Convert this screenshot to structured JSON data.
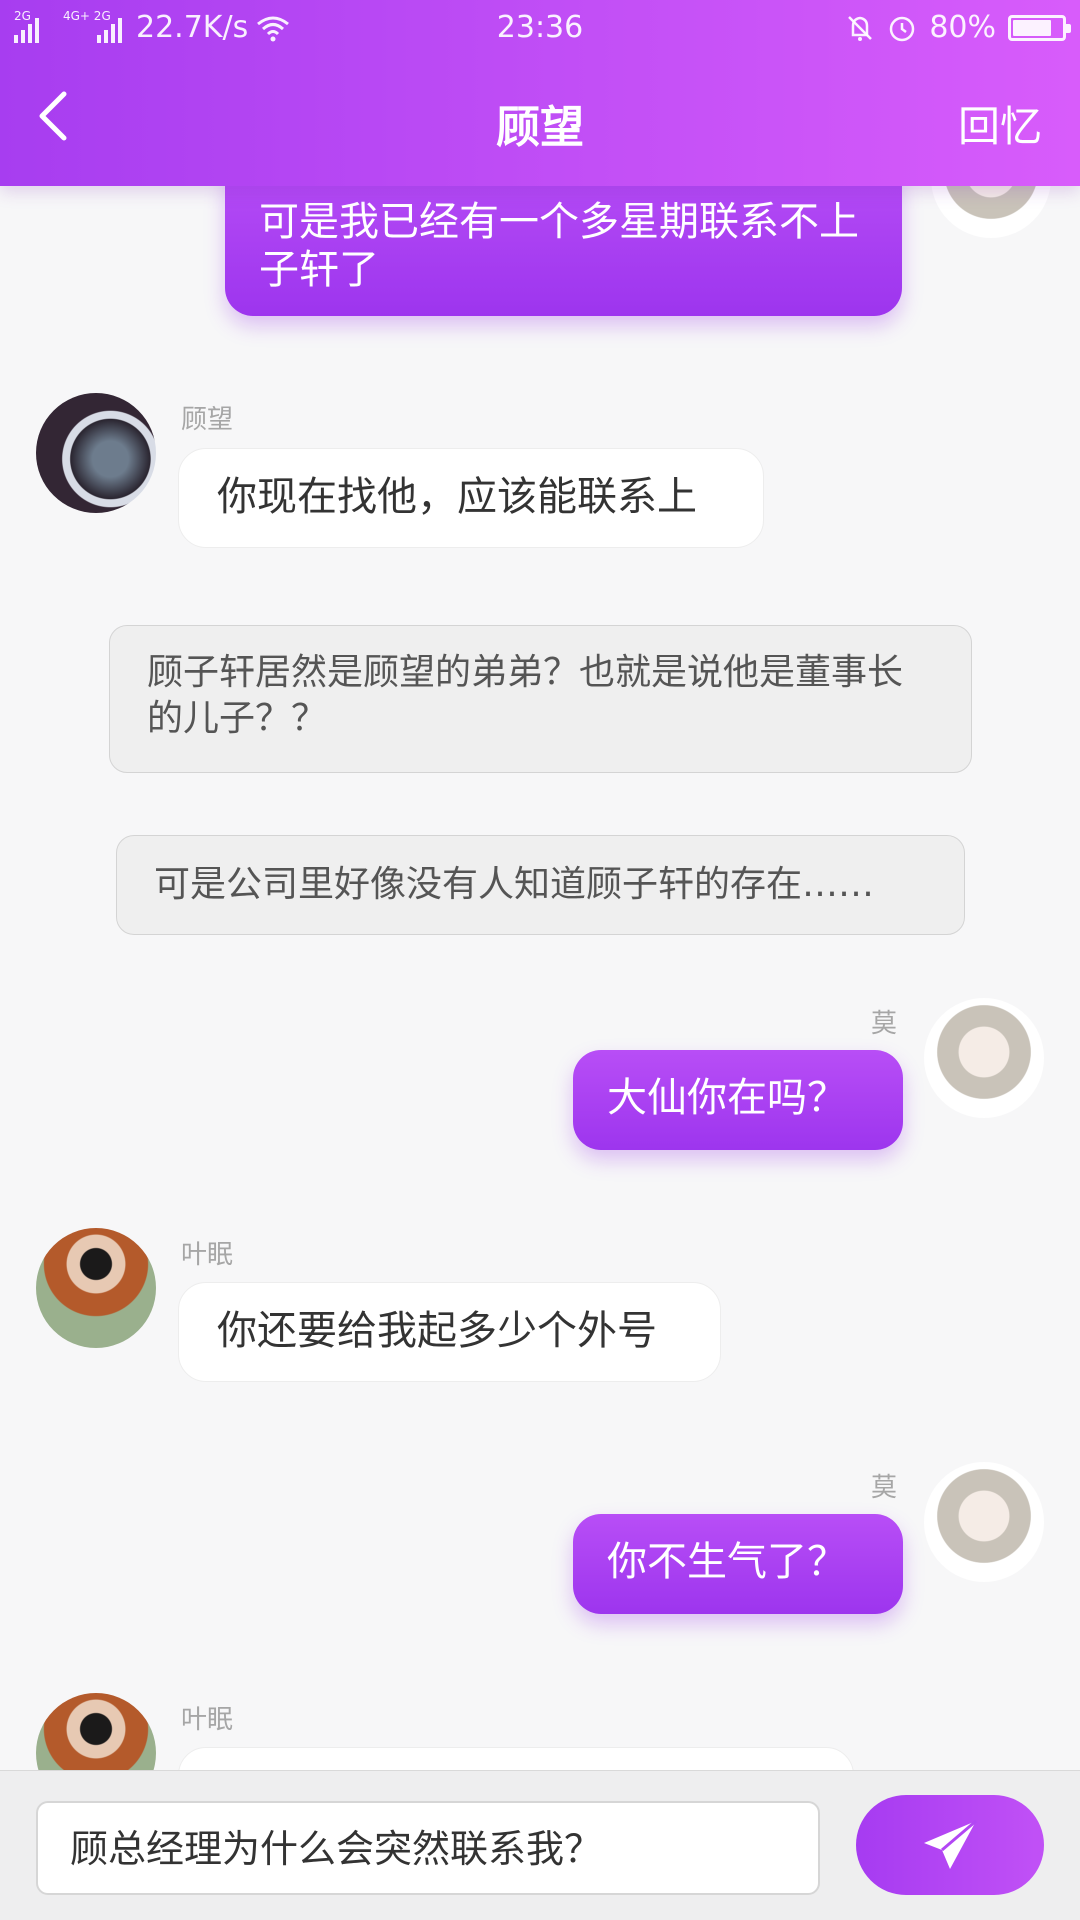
{
  "status_bar": {
    "signal1_tag": "2G",
    "signal2_tag": "4G+ 2G",
    "net_speed": "22.7K/s",
    "time": "23:36",
    "battery": "80%",
    "battery_level": 0.8
  },
  "header": {
    "title": "顾望",
    "right_action": "回忆"
  },
  "messages": {
    "m1": {
      "text": "可是我已经有一个多星期联系不上子轩了"
    },
    "m2": {
      "name": "顾望",
      "text": "你现在找他，应该能联系上"
    },
    "m3": {
      "text": "顾子轩居然是顾望的弟弟？也就是说他是董事长的儿子？？"
    },
    "m4": {
      "text": "可是公司里好像没有人知道顾子轩的存在……"
    },
    "m5": {
      "name": "莫",
      "text": "大仙你在吗？"
    },
    "m6": {
      "name": "叶眠",
      "text": "你还要给我起多少个外号"
    },
    "m7": {
      "name": "莫",
      "text": "你不生气了？"
    },
    "m8": {
      "name": "叶眠",
      "text": ""
    }
  },
  "input": {
    "value": "顾总经理为什么会突然联系我？"
  },
  "colors": {
    "accent": "#a73df0",
    "accent_light": "#d85cfb"
  }
}
